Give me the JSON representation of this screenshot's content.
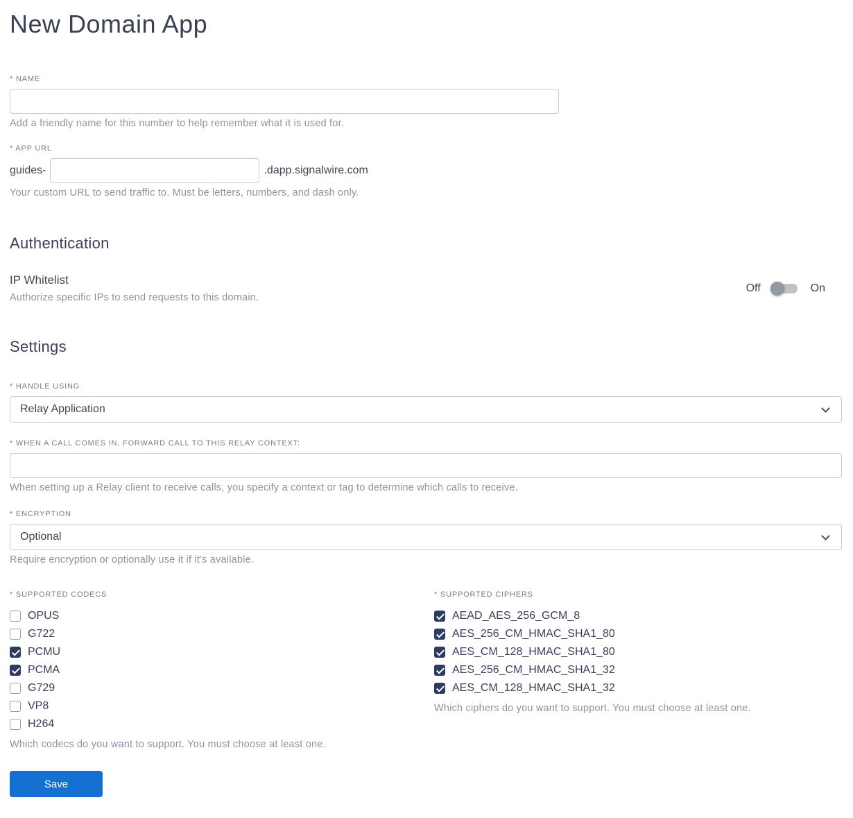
{
  "page": {
    "title": "New Domain App"
  },
  "name_field": {
    "label": "* NAME",
    "value": "",
    "helper": "Add a friendly name for this number to help remember what it is used for."
  },
  "app_url_field": {
    "label": "* APP URL",
    "prefix": "guides-",
    "value": "",
    "suffix": ".dapp.signalwire.com",
    "helper": "Your custom URL to send traffic to. Must be letters, numbers, and dash only."
  },
  "authentication": {
    "heading": "Authentication",
    "ip_whitelist": {
      "label": "IP Whitelist",
      "helper": "Authorize specific IPs to send requests to this domain.",
      "off_label": "Off",
      "on_label": "On",
      "state": "off"
    }
  },
  "settings": {
    "heading": "Settings",
    "handle_using": {
      "label": "* HANDLE USING",
      "value": "Relay Application"
    },
    "relay_context": {
      "label": "* WHEN A CALL COMES IN, FORWARD CALL TO THIS RELAY CONTEXT:",
      "value": "",
      "helper": "When setting up a Relay client to receive calls, you specify a context or tag to determine which calls to receive."
    },
    "encryption": {
      "label": "* ENCRYPTION",
      "value": "Optional",
      "helper": "Require encryption or optionally use it if it's available."
    },
    "codecs": {
      "label": "* SUPPORTED CODECS",
      "options": [
        {
          "label": "OPUS",
          "checked": false
        },
        {
          "label": "G722",
          "checked": false
        },
        {
          "label": "PCMU",
          "checked": true
        },
        {
          "label": "PCMA",
          "checked": true
        },
        {
          "label": "G729",
          "checked": false
        },
        {
          "label": "VP8",
          "checked": false
        },
        {
          "label": "H264",
          "checked": false
        }
      ],
      "helper": "Which codecs do you want to support. You must choose at least one."
    },
    "ciphers": {
      "label": "* SUPPORTED CIPHERS",
      "options": [
        {
          "label": "AEAD_AES_256_GCM_8",
          "checked": true
        },
        {
          "label": "AES_256_CM_HMAC_SHA1_80",
          "checked": true
        },
        {
          "label": "AES_CM_128_HMAC_SHA1_80",
          "checked": true
        },
        {
          "label": "AES_256_CM_HMAC_SHA1_32",
          "checked": true
        },
        {
          "label": "AES_CM_128_HMAC_SHA1_32",
          "checked": true
        }
      ],
      "helper": "Which ciphers do you want to support. You must choose at least one."
    }
  },
  "save_button": {
    "label": "Save"
  },
  "colors": {
    "accent": "#1670d1",
    "checkbox": "#2e3b60",
    "heading": "#3a4154"
  }
}
